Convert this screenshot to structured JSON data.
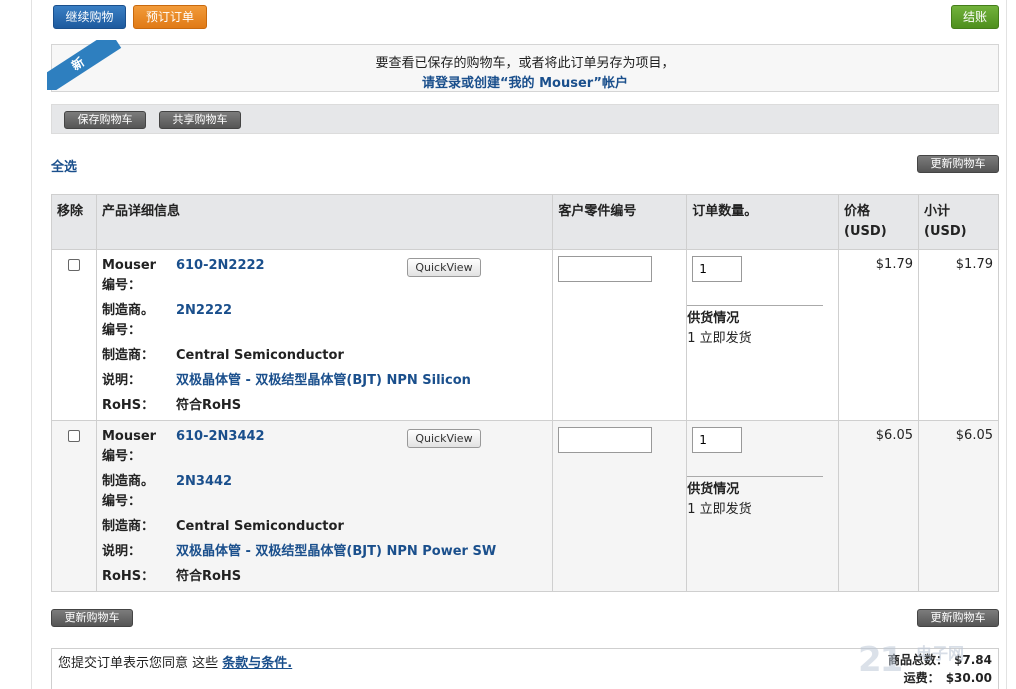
{
  "top_buttons": {
    "continue_shopping": "继续购物",
    "pre_order": "预订订单",
    "checkout": "结账"
  },
  "notice": {
    "badge": "新",
    "line1": "要查看已保存的购物车，或者将此订单另存为项目，",
    "line2": "请登录或创建“我的 Mouser”帐户"
  },
  "save_bar": {
    "save_cart": "保存购物车",
    "share_cart": "共享购物车"
  },
  "select_all": "全选",
  "update_cart": "更新购物车",
  "table": {
    "headers": {
      "remove": "移除",
      "product_details": "产品详细信息",
      "customer_part": "客户零件编号",
      "quantity": "订单数量。",
      "price": "价格\n(USD)",
      "price_l1": "价格",
      "price_l2": "(USD)",
      "subtotal_l1": "小计",
      "subtotal_l2": "(USD)"
    },
    "labels": {
      "mouser_no_l1": "Mouser",
      "mouser_no_l2": "编号：",
      "mfr_no_l1": "制造商。",
      "mfr_no_l2": "编号：",
      "manufacturer": "制造商：",
      "description": "说明：",
      "rohs": "RoHS："
    },
    "quickview": "QuickView",
    "supply_heading": "供货情况",
    "rows": [
      {
        "mouser_no": "610-2N2222",
        "mfr_no": "2N2222",
        "manufacturer": "Central Semiconductor",
        "description": "双极晶体管 - 双极结型晶体管(BJT) NPN Silicon",
        "rohs": "符合RoHS",
        "customer_part": "",
        "qty": "1",
        "availability": "1 立即发货",
        "price": "$1.79",
        "subtotal": "$1.79"
      },
      {
        "mouser_no": "610-2N3442",
        "mfr_no": "2N3442",
        "manufacturer": "Central Semiconductor",
        "description": "双极晶体管 - 双极结型晶体管(BJT) NPN Power SW",
        "rohs": "符合RoHS",
        "customer_part": "",
        "qty": "1",
        "availability": "1 立即发货",
        "price": "$6.05",
        "subtotal": "$6.05"
      }
    ]
  },
  "footer": {
    "terms_prefix": "您提交订单表示您同意 这些 ",
    "terms_link": "条款与条件.",
    "goods_total_label": "商品总数：",
    "goods_total": "$7.84",
    "shipping_label": "运费：",
    "shipping": "$30.00"
  },
  "watermark": {
    "main": "21",
    "sub": "电子网"
  }
}
